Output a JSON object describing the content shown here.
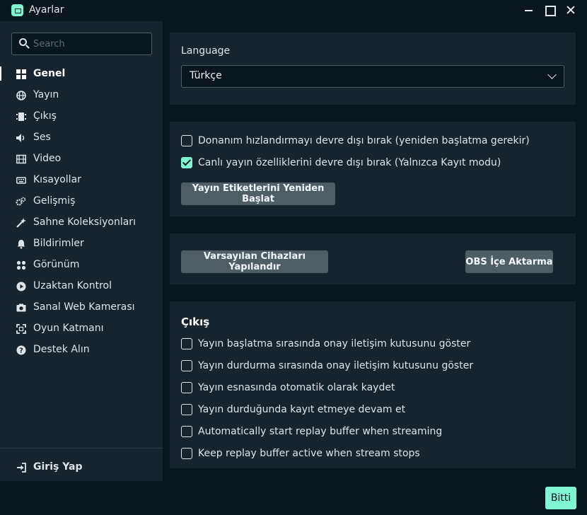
{
  "window": {
    "title": "Ayarlar"
  },
  "search": {
    "placeholder": "Search"
  },
  "sidebar": {
    "items": [
      {
        "label": "Genel",
        "icon": "dashboard-icon",
        "active": true
      },
      {
        "label": "Yayın",
        "icon": "globe-icon"
      },
      {
        "label": "Çıkış",
        "icon": "output-icon"
      },
      {
        "label": "Ses",
        "icon": "speaker-icon"
      },
      {
        "label": "Video",
        "icon": "film-icon"
      },
      {
        "label": "Kısayollar",
        "icon": "keyboard-icon"
      },
      {
        "label": "Gelişmiş",
        "icon": "gears-icon"
      },
      {
        "label": "Sahne Koleksiyonları",
        "icon": "magic-wand-icon"
      },
      {
        "label": "Bildirimler",
        "icon": "bell-icon"
      },
      {
        "label": "Görünüm",
        "icon": "palette-icon"
      },
      {
        "label": "Uzaktan Kontrol",
        "icon": "play-circle-icon"
      },
      {
        "label": "Sanal Web Kamerası",
        "icon": "camera-icon"
      },
      {
        "label": "Oyun Katmanı",
        "icon": "expand-icon"
      },
      {
        "label": "Destek Alın",
        "icon": "question-circle-icon"
      }
    ],
    "login_label": "Giriş Yap"
  },
  "language": {
    "label": "Language",
    "selected": "Türkçe"
  },
  "hardware": {
    "option1": {
      "label": "Donanım hızlandırmayı devre dışı bırak (yeniden başlatma gerekir)",
      "checked": false
    },
    "option2": {
      "label": "Canlı yayın özelliklerini devre dışı bırak (Yalnızca Kayıt modu)",
      "checked": true
    },
    "restart_button": "Yayın Etiketlerini Yeniden Başlat"
  },
  "devices": {
    "configure_button": "Varsayılan Cihazları Yapılandır",
    "obs_import_button": "OBS İçe Aktarma"
  },
  "output": {
    "title": "Çıkış",
    "options": [
      {
        "label": "Yayın başlatma sırasında onay iletişim kutusunu göster",
        "checked": false
      },
      {
        "label": "Yayın durdurma sırasında onay iletişim kutusunu göster",
        "checked": false
      },
      {
        "label": "Yayın esnasında otomatik olarak kaydet",
        "checked": false
      },
      {
        "label": "Yayın durduğunda kayıt etmeye devam et",
        "checked": false
      },
      {
        "label": "Automatically start replay buffer when streaming",
        "checked": false
      },
      {
        "label": "Keep replay buffer active when stream stops",
        "checked": false
      }
    ]
  },
  "footer": {
    "done_button": "Bitti"
  },
  "colors": {
    "accent": "#80f5d2",
    "panel": "#17242d",
    "background": "#09161d",
    "button": "#4f5e65"
  }
}
